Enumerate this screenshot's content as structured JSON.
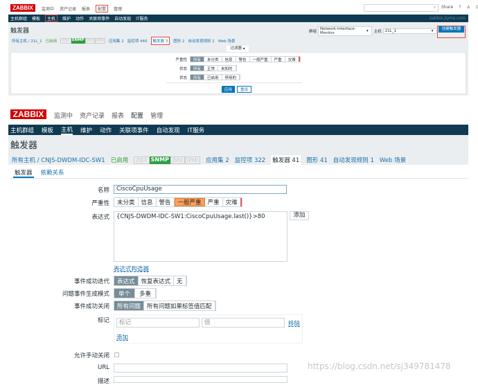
{
  "top": {
    "logo": "ZABBIX",
    "menu": [
      "监测中",
      "资产记录",
      "报表",
      "配置",
      "管理"
    ],
    "right": {
      "share": "Share",
      "help": "?"
    },
    "submenu": [
      "主机群组",
      "模板",
      "主机",
      "维护",
      "动作",
      "关联项事件",
      "自动发现",
      "IT服务"
    ],
    "server": "zabbix.jiyms.com",
    "title": "触发器",
    "group_label": "群组",
    "group_value": "Network-Interface-Monitor",
    "host_label": "主机",
    "host_value": "21L_1",
    "create_button": "创建触发器",
    "breadcrumb": {
      "all": "所有主机 / 21L_1",
      "enabled": "已启用",
      "zbx": "ZBX",
      "snmp": "SNMP",
      "jmx": "JMX",
      "ipmi": "IPMI",
      "apps": "应用集 2",
      "items": "监控项 440",
      "triggers": "触发器 3",
      "graphs": "图形 2",
      "discovery": "自动发现规则 1",
      "web": "Web 场景"
    },
    "filter_tab": "过滤器 ▴",
    "filter": {
      "severity_label": "严重性",
      "severity": [
        "所有",
        "未分类",
        "信息",
        "警告",
        "一般严重",
        "严重",
        "灾难"
      ],
      "state_label": "状态",
      "state": [
        "所有",
        "正常",
        "未知的"
      ],
      "status_label": "状态",
      "status": [
        "所有",
        "已启用",
        "停用的"
      ],
      "apply": "应用",
      "reset": "重设"
    }
  },
  "bottom": {
    "logo": "ZABBIX",
    "menu": [
      "监测中",
      "资产记录",
      "报表",
      "配置",
      "管理"
    ],
    "submenu": [
      "主机群组",
      "模板",
      "主机",
      "维护",
      "动作",
      "关联项事件",
      "自动发现",
      "IT服务"
    ],
    "title": "触发器",
    "breadcrumb": {
      "all": "所有主机 / CNJS-DWDM-IDC-SW1",
      "enabled": "已启用",
      "zbx": "ZBX",
      "snmp": "SNMP",
      "jmx": "JMX",
      "ipmi": "IPMI",
      "apps": "应用集 2",
      "items": "监控项 322",
      "triggers": "触发器 41",
      "graphs": "图形 41",
      "discovery": "自动发现规则 1",
      "web": "Web 场景"
    },
    "tabs": [
      "触发器",
      "依赖关系"
    ],
    "form": {
      "name_label": "名称",
      "name_value": "CiscoCpuUsage",
      "severity_label": "严重性",
      "severity": [
        "未分类",
        "信息",
        "警告",
        "一般严重",
        "严重",
        "灾难"
      ],
      "expr_label": "表达式",
      "expr_value": "{CNJS-DWDM-IDC-SW1:CiscoCpuUsage.last()}>80",
      "add": "添加",
      "builder": "表达式构造器",
      "ok_gen_label": "事件成功迭代",
      "ok_gen": [
        "表达式",
        "恢复表达式",
        "无"
      ],
      "mode_label": "问题事件生成模式",
      "mode": [
        "单个",
        "多重"
      ],
      "ok_close_label": "事件成功关闭",
      "ok_close": [
        "所有问题",
        "所有问题如果标签值匹配"
      ],
      "tags_label": "标记",
      "tag_ph": "标记",
      "value_ph": "值",
      "remove": "移除",
      "tag_add": "添加",
      "manual_label": "允许手动关闭",
      "url_label": "URL",
      "desc_label": "描述"
    }
  },
  "watermark": "https://blog.csdn.net/sj349781478"
}
